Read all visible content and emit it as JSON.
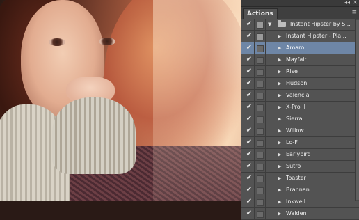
{
  "panel": {
    "tab_label": "Actions",
    "collapse_glyph": "◂◂",
    "close_glyph": "✕",
    "menu_glyph": "≡"
  },
  "actions": [
    {
      "label": "Instant Hipster by S...",
      "type": "set",
      "checked": true,
      "dialog": true,
      "expanded": true
    },
    {
      "label": "Instant Hipster - Pla...",
      "type": "action",
      "checked": true,
      "dialog": true,
      "expanded": false
    },
    {
      "label": "Amaro",
      "type": "step",
      "checked": true,
      "dialog": false,
      "selected": true
    },
    {
      "label": "Mayfair",
      "type": "step",
      "checked": true,
      "dialog": false
    },
    {
      "label": "Rise",
      "type": "step",
      "checked": true,
      "dialog": false
    },
    {
      "label": "Hudson",
      "type": "step",
      "checked": true,
      "dialog": false
    },
    {
      "label": "Valencia",
      "type": "step",
      "checked": true,
      "dialog": false
    },
    {
      "label": "X-Pro II",
      "type": "step",
      "checked": true,
      "dialog": false
    },
    {
      "label": "Sierra",
      "type": "step",
      "checked": true,
      "dialog": false
    },
    {
      "label": "Willow",
      "type": "step",
      "checked": true,
      "dialog": false
    },
    {
      "label": "Lo-Fi",
      "type": "step",
      "checked": true,
      "dialog": false
    },
    {
      "label": "Earlybird",
      "type": "step",
      "checked": true,
      "dialog": false
    },
    {
      "label": "Sutro",
      "type": "step",
      "checked": true,
      "dialog": false
    },
    {
      "label": "Toaster",
      "type": "step",
      "checked": true,
      "dialog": false
    },
    {
      "label": "Brannan",
      "type": "step",
      "checked": true,
      "dialog": false
    },
    {
      "label": "Inkwell",
      "type": "step",
      "checked": true,
      "dialog": false
    },
    {
      "label": "Walden",
      "type": "step",
      "checked": true,
      "dialog": false
    }
  ],
  "colors": {
    "panel_bg": "#535353",
    "selection": "#6e86a6"
  }
}
